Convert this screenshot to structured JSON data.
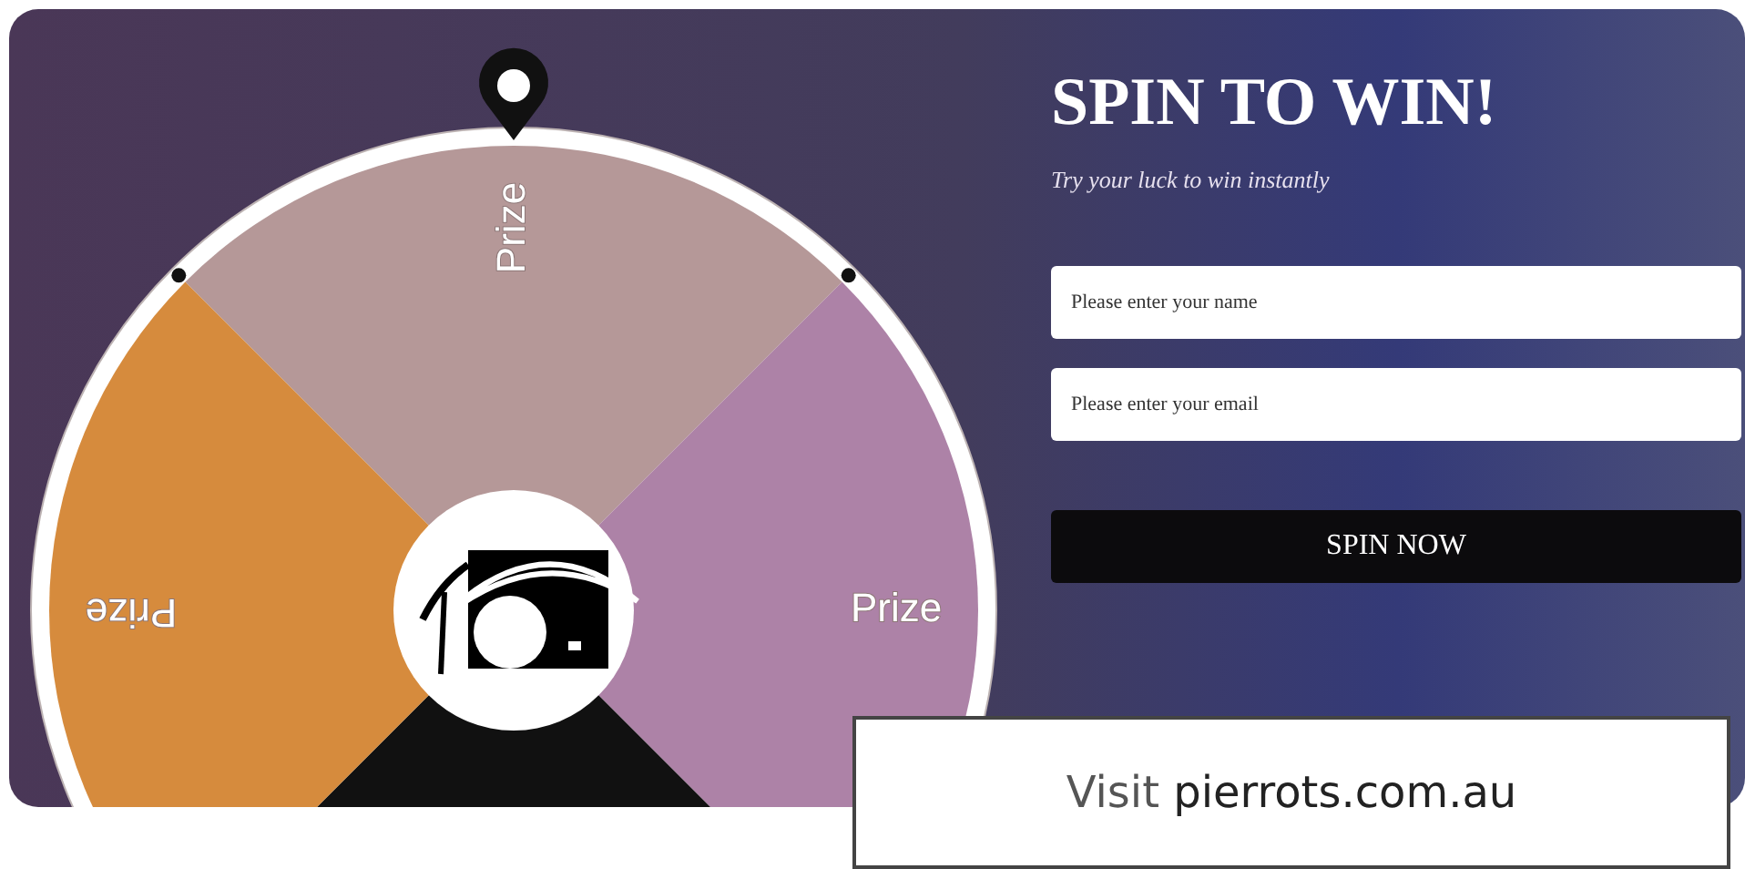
{
  "wheel": {
    "segments": [
      {
        "label": "Prize",
        "color": "#b59898"
      },
      {
        "label": "Prize",
        "color": "#ad82a7"
      },
      {
        "color": "#111111"
      },
      {
        "label": "Prize",
        "color": "#d68b3d"
      }
    ]
  },
  "form": {
    "title": "SPIN TO WIN!",
    "subtitle": "Try your luck to win instantly",
    "fields": [
      {
        "placeholder": "Please enter your name"
      },
      {
        "placeholder": "Please enter your email"
      }
    ],
    "button": "SPIN NOW"
  },
  "banner": {
    "text": "Visit **pierrots.com.au**"
  }
}
